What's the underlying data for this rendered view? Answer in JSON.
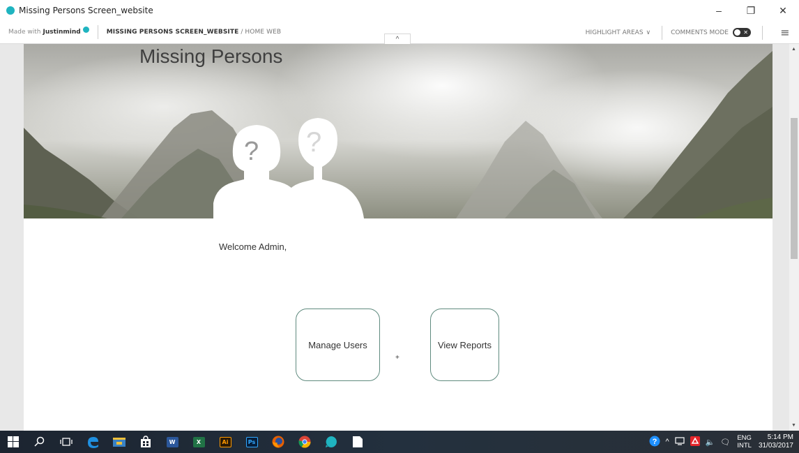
{
  "window": {
    "title": "Missing Persons Screen_website",
    "minimize": "–",
    "restore": "❐",
    "close": "✕"
  },
  "toolbar": {
    "made_with_prefix": "Made with",
    "made_with_brand": "Justinmind",
    "breadcrumb_project": "MISSING PERSONS SCREEN_WEBSITE",
    "breadcrumb_sep": " / ",
    "breadcrumb_page": "HOME WEB",
    "collapse": "^",
    "highlight_areas": "HIGHLIGHT AREAS",
    "highlight_chevron": "∨",
    "comments_mode": "COMMENTS MODE",
    "toggle_x": "✕",
    "menu": "≡",
    "accent": "#1fb4c0"
  },
  "page": {
    "title": "Missing Persons",
    "question_mark": "?",
    "welcome": "Welcome Admin,",
    "manage_users": "Manage Users",
    "plus": "+",
    "view_reports": "View Reports",
    "card_border": "#5f8a7e"
  },
  "scrollbar": {
    "up": "▲",
    "down": "▼"
  },
  "taskbar": {
    "icons": [
      "windows-icon",
      "search-icon",
      "task-view-icon",
      "edge-icon",
      "file-explorer-icon",
      "store-icon",
      "word-icon",
      "excel-icon",
      "illustrator-icon",
      "photoshop-icon",
      "firefox-icon",
      "chrome-icon",
      "justinmind-icon",
      "notepad-icon"
    ],
    "word_label": "W",
    "excel_label": "X",
    "ai_label": "Ai",
    "ps_label": "Ps",
    "lang_top": "ENG",
    "lang_bottom": "INTL",
    "time": "5:14 PM",
    "date": "31/03/2017",
    "tray_up": "^",
    "help": "?",
    "volume": "🔈",
    "notifications": "🗨"
  }
}
